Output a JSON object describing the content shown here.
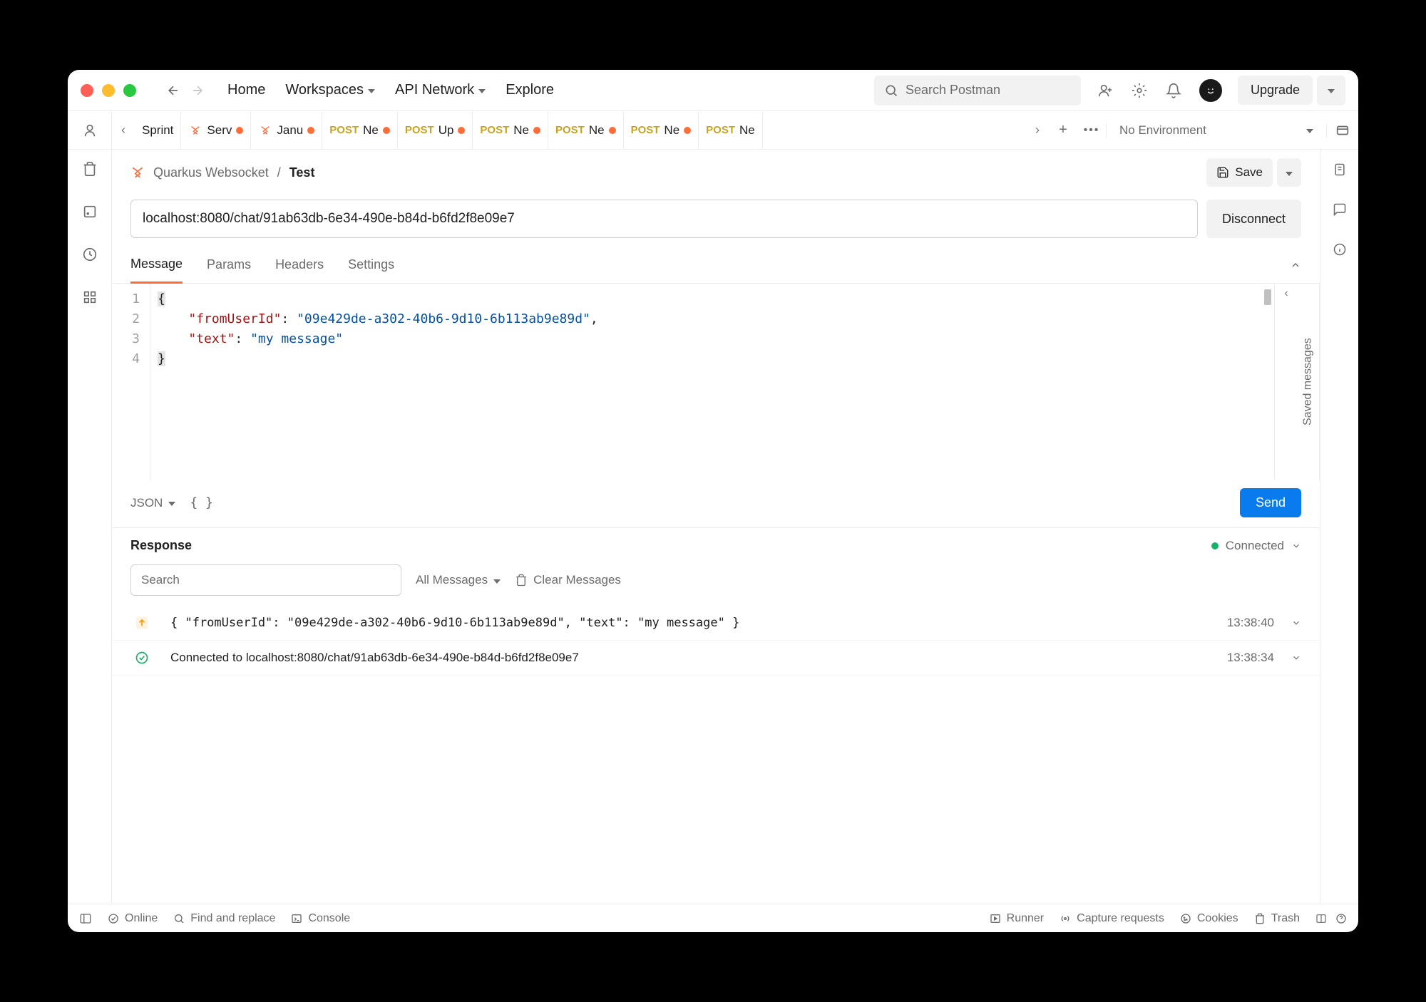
{
  "header": {
    "nav": {
      "home": "Home",
      "workspaces": "Workspaces",
      "apiNetwork": "API Network",
      "explore": "Explore"
    },
    "searchPlaceholder": "Search Postman",
    "upgrade": "Upgrade"
  },
  "tabs": [
    {
      "kind": "text",
      "label": "Sprint"
    },
    {
      "kind": "ws",
      "label": "Serv",
      "dirty": true
    },
    {
      "kind": "ws",
      "label": "Janu",
      "dirty": true
    },
    {
      "kind": "http",
      "method": "POST",
      "label": "Ne",
      "dirty": true
    },
    {
      "kind": "http",
      "method": "POST",
      "label": "Up",
      "dirty": true
    },
    {
      "kind": "http",
      "method": "POST",
      "label": "Ne",
      "dirty": true
    },
    {
      "kind": "http",
      "method": "POST",
      "label": "Ne",
      "dirty": true
    },
    {
      "kind": "http",
      "method": "POST",
      "label": "Ne",
      "dirty": true
    },
    {
      "kind": "http",
      "method": "POST",
      "label": "Ne",
      "dirty": false
    }
  ],
  "environment": "No Environment",
  "breadcrumb": {
    "collection": "Quarkus Websocket",
    "name": "Test",
    "save": "Save"
  },
  "url": "localhost:8080/chat/91ab63db-6e34-490e-b84d-b6fd2f8e09e7",
  "disconnect": "Disconnect",
  "subtabs": {
    "message": "Message",
    "params": "Params",
    "headers": "Headers",
    "settings": "Settings"
  },
  "editor": {
    "lines": [
      "1",
      "2",
      "3",
      "4"
    ],
    "body": {
      "fromUserId": "09e429de-a302-40b6-9d10-6b113ab9e89d",
      "text": "my message"
    },
    "savedMessages": "Saved messages"
  },
  "editorFoot": {
    "lang": "JSON",
    "send": "Send"
  },
  "response": {
    "title": "Response",
    "connected": "Connected",
    "searchPlaceholder": "Search",
    "allMessages": "All Messages",
    "clear": "Clear Messages",
    "rows": [
      {
        "type": "sent",
        "text": "{ \"fromUserId\": \"09e429de-a302-40b6-9d10-6b113ab9e89d\", \"text\": \"my message\" }",
        "time": "13:38:40"
      },
      {
        "type": "status",
        "text": "Connected to localhost:8080/chat/91ab63db-6e34-490e-b84d-b6fd2f8e09e7",
        "time": "13:38:34"
      }
    ]
  },
  "footer": {
    "online": "Online",
    "find": "Find and replace",
    "console": "Console",
    "runner": "Runner",
    "capture": "Capture requests",
    "cookies": "Cookies",
    "trash": "Trash"
  }
}
